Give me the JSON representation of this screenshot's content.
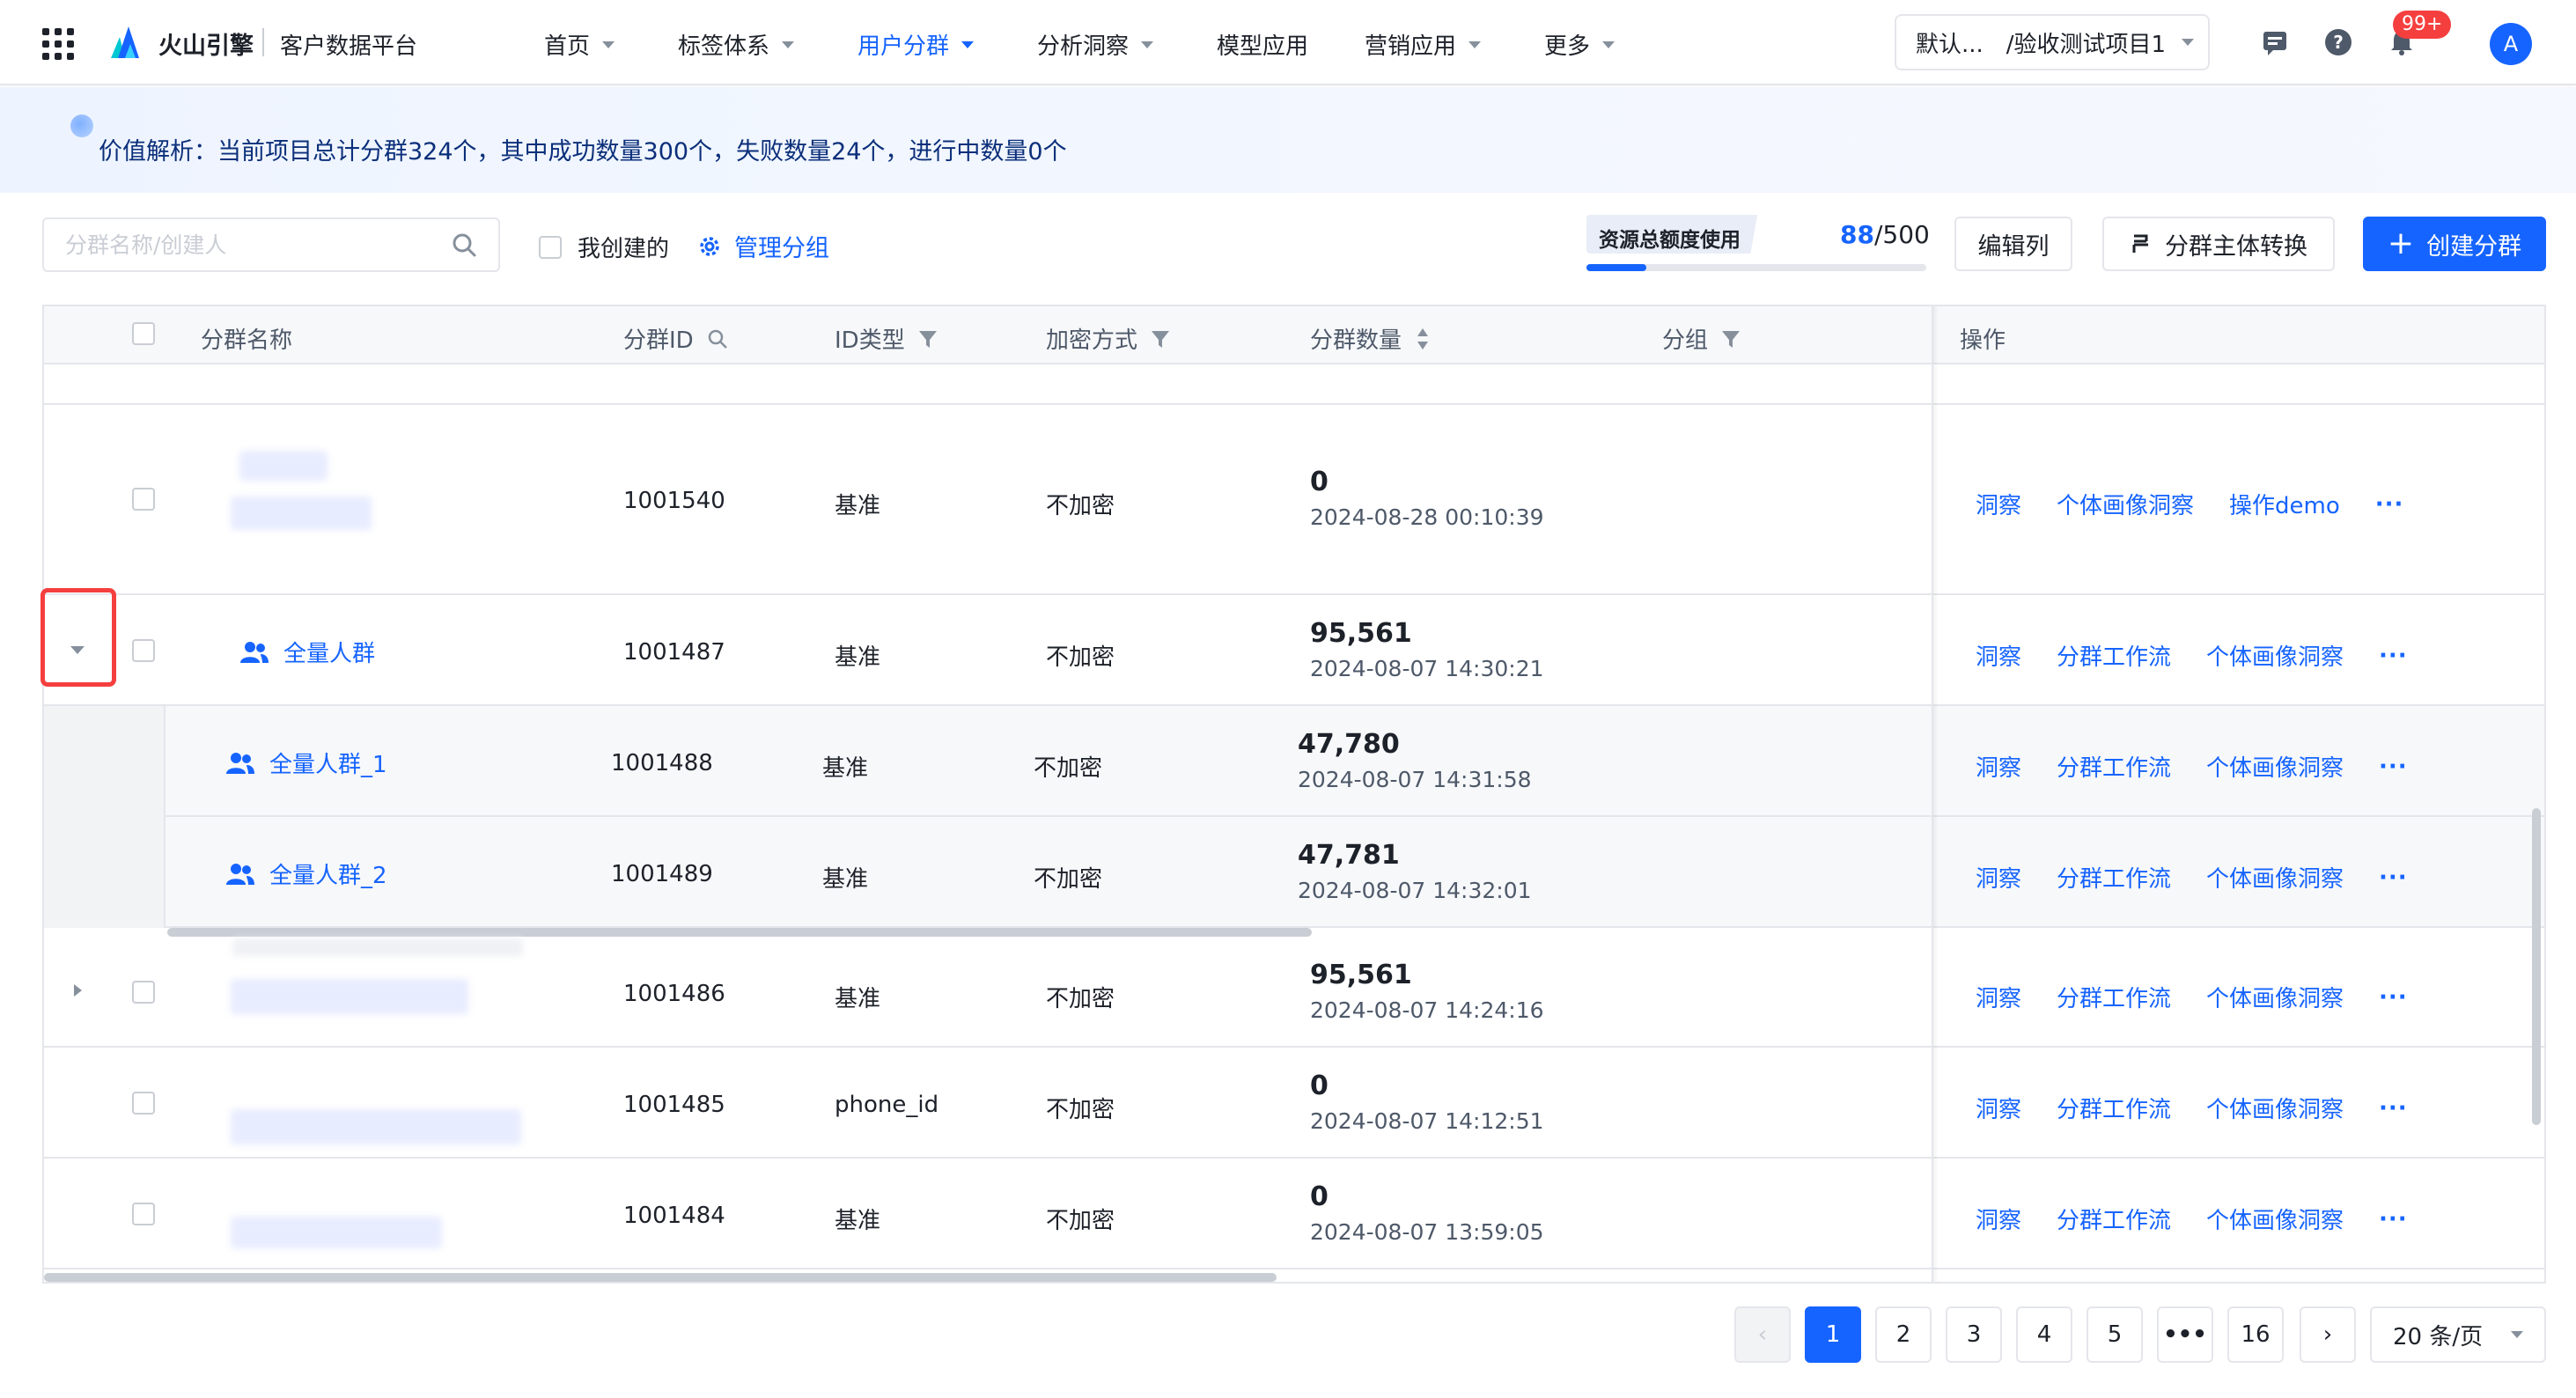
{
  "nav": {
    "brand": "火山引擎",
    "product": "客户数据平台",
    "items": [
      {
        "label": "首页",
        "dropdown": true,
        "active": false
      },
      {
        "label": "标签体系",
        "dropdown": true,
        "active": false
      },
      {
        "label": "用户分群",
        "dropdown": true,
        "active": true
      },
      {
        "label": "分析洞察",
        "dropdown": true,
        "active": false
      },
      {
        "label": "模型应用",
        "dropdown": false,
        "active": false
      },
      {
        "label": "营销应用",
        "dropdown": true,
        "active": false
      },
      {
        "label": "更多",
        "dropdown": true,
        "active": false
      }
    ],
    "project": "默认...　/验收测试项目1",
    "notification_badge": "99+",
    "avatar_initial": "A"
  },
  "banner": {
    "text": "价值解析：当前项目总计分群324个，其中成功数量300个，失败数量24个，进行中数量0个"
  },
  "toolbar": {
    "search_placeholder": "分群名称/创建人",
    "mine_label": "我创建的",
    "manage_label": "管理分组",
    "quota_label": "资源总额度使用",
    "quota_used": "88",
    "quota_total": "/500",
    "quota_fraction": 0.176,
    "edit_columns": "编辑列",
    "switch_entity": "分群主体转换",
    "create": "创建分群"
  },
  "table": {
    "headers": {
      "name": "分群名称",
      "id": "分群ID",
      "id_type": "ID类型",
      "encrypt": "加密方式",
      "count": "分群数量",
      "group": "分组",
      "ops": "操作"
    },
    "rows": [
      {
        "id": "1001540",
        "id_type": "基准",
        "encrypt": "不加密",
        "count": "0",
        "time": "2024-08-28 00:10:39",
        "ops": [
          "洞察",
          "个体画像洞察",
          "操作demo"
        ]
      },
      {
        "name": "全量人群",
        "id": "1001487",
        "id_type": "基准",
        "encrypt": "不加密",
        "count": "95,561",
        "time": "2024-08-07 14:30:21",
        "ops": [
          "洞察",
          "分群工作流",
          "个体画像洞察"
        ],
        "expanded": true
      },
      {
        "name": "全量人群_1",
        "id": "1001488",
        "id_type": "基准",
        "encrypt": "不加密",
        "count": "47,780",
        "time": "2024-08-07 14:31:58",
        "ops": [
          "洞察",
          "分群工作流",
          "个体画像洞察"
        ],
        "child": true
      },
      {
        "name": "全量人群_2",
        "id": "1001489",
        "id_type": "基准",
        "encrypt": "不加密",
        "count": "47,781",
        "time": "2024-08-07 14:32:01",
        "ops": [
          "洞察",
          "分群工作流",
          "个体画像洞察"
        ],
        "child": true
      },
      {
        "id": "1001486",
        "id_type": "基准",
        "encrypt": "不加密",
        "count": "95,561",
        "time": "2024-08-07 14:24:16",
        "ops": [
          "洞察",
          "分群工作流",
          "个体画像洞察"
        ]
      },
      {
        "id": "1001485",
        "id_type": "phone_id",
        "encrypt": "不加密",
        "count": "0",
        "time": "2024-08-07 14:12:51",
        "ops": [
          "洞察",
          "分群工作流",
          "个体画像洞察"
        ]
      },
      {
        "id": "1001484",
        "id_type": "基准",
        "encrypt": "不加密",
        "count": "0",
        "time": "2024-08-07 13:59:05",
        "ops": [
          "洞察",
          "分群工作流",
          "个体画像洞察"
        ]
      }
    ],
    "more_glyph": "···"
  },
  "pagination": {
    "pages": [
      "1",
      "2",
      "3",
      "4",
      "5",
      "•••",
      "16"
    ],
    "current": "1",
    "page_size": "20 条/页"
  },
  "colors": {
    "primary": "#1664ff",
    "danger": "#f53f3f",
    "border": "#e5e6eb"
  }
}
